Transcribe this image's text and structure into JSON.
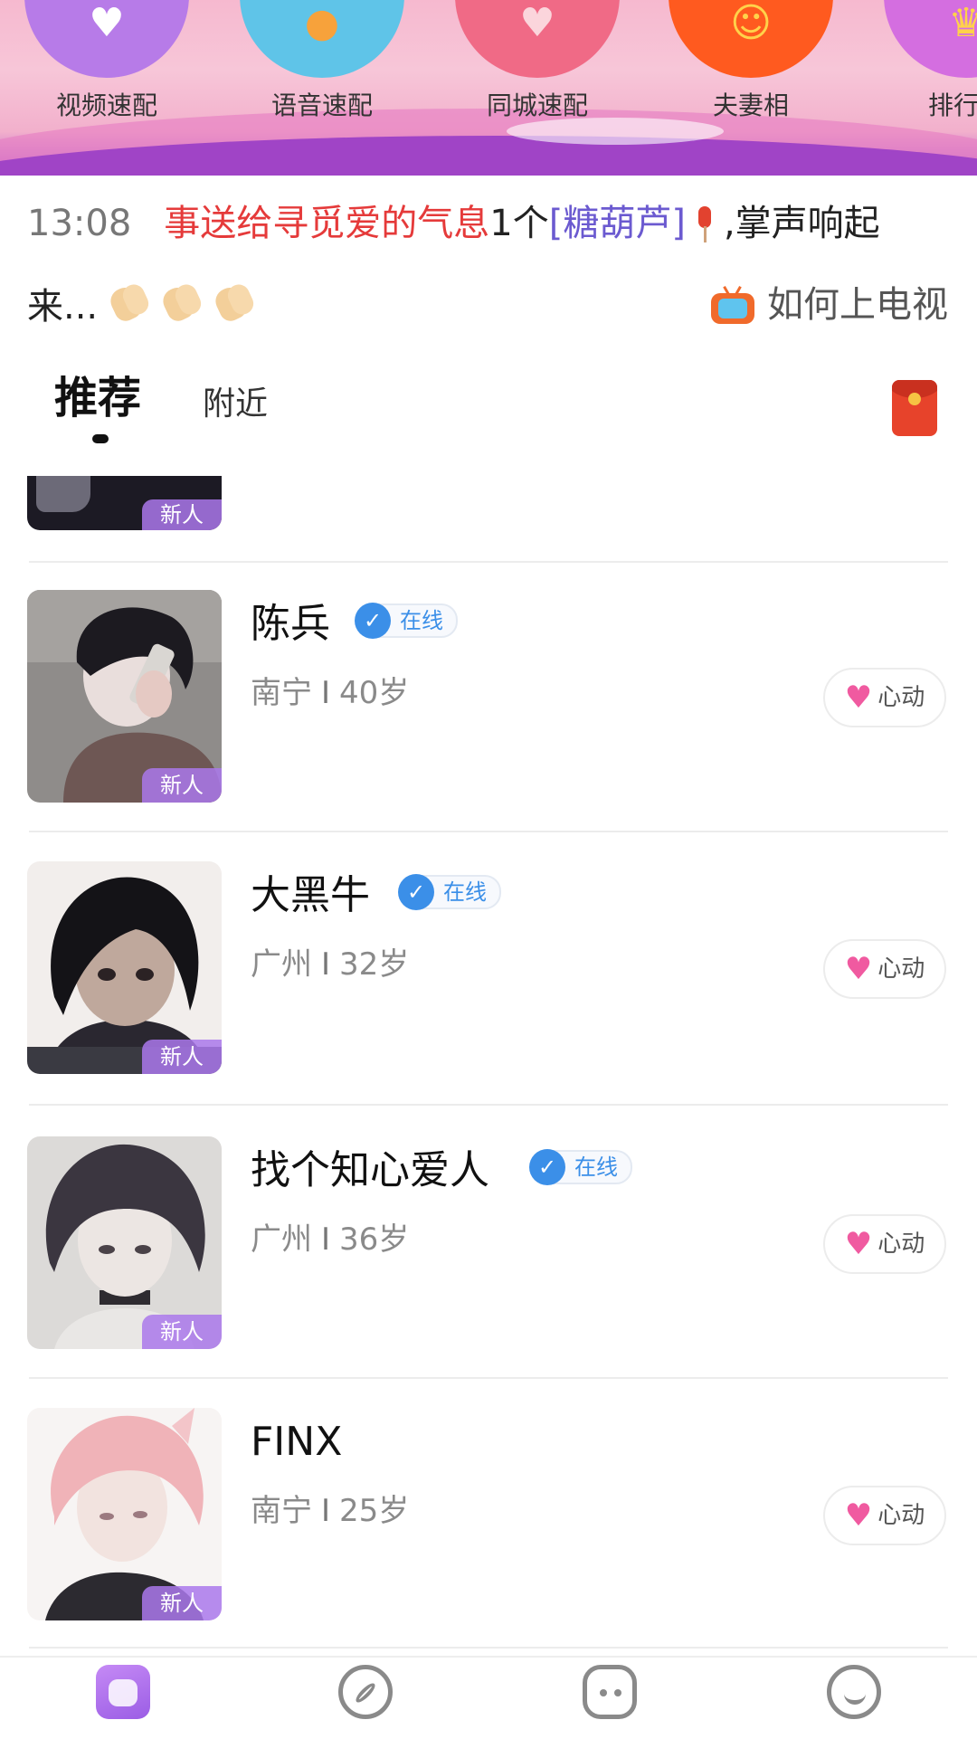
{
  "quick_match": [
    {
      "label": "视频速配",
      "icon": "video-heart-icon",
      "color": "#b77be8"
    },
    {
      "label": "语音速配",
      "icon": "microphone-icon",
      "color": "#5fc4e8"
    },
    {
      "label": "同城速配",
      "icon": "hearts-icon",
      "color": "#f06a86"
    },
    {
      "label": "夫妻相",
      "icon": "smiley-face-icon",
      "color": "#ff5a1f"
    },
    {
      "label": "排行",
      "icon": "trophy-icon",
      "color": "#d46ee0"
    }
  ],
  "notice": {
    "time": "13:08",
    "part_red_1": "事送给",
    "part_red_2": "寻觅爱的气息",
    "part_dark_1": "1个",
    "part_purple": "[糖葫芦]",
    "part_dark_2": ",掌声响起",
    "line2_text": "来...",
    "tv_link": "如何上电视"
  },
  "tabs": {
    "recommend": "推荐",
    "nearby": "附近"
  },
  "users": [
    {
      "name": "陈兵",
      "online": true,
      "online_label": "在线",
      "city": "南宁",
      "separator": "I",
      "age": "40岁",
      "badge": "新人",
      "like_label": "心动"
    },
    {
      "name": "大黑牛",
      "online": true,
      "online_label": "在线",
      "city": "广州",
      "separator": "I",
      "age": "32岁",
      "badge": "新人",
      "like_label": "心动"
    },
    {
      "name": "找个知心爱人",
      "online": true,
      "online_label": "在线",
      "city": "广州",
      "separator": "I",
      "age": "36岁",
      "badge": "新人",
      "like_label": "心动"
    },
    {
      "name": "FINX",
      "online": false,
      "online_label": "",
      "city": "南宁",
      "separator": "I",
      "age": "25岁",
      "badge": "新人",
      "like_label": "心动"
    }
  ],
  "partial_user": {
    "badge": "新人"
  },
  "colors": {
    "accent_purple": "#9b5de5",
    "verified_blue": "#3b8fe8",
    "heart_pink": "#f05aa0",
    "notice_red": "#e53a3a",
    "notice_purple": "#6b5ad0"
  },
  "bottom_nav": [
    {
      "name": "home",
      "icon": "home-icon",
      "active": true
    },
    {
      "name": "discover",
      "icon": "compass-icon",
      "active": false
    },
    {
      "name": "messages",
      "icon": "chat-icon",
      "active": false
    },
    {
      "name": "me",
      "icon": "smile-icon",
      "active": false
    }
  ]
}
